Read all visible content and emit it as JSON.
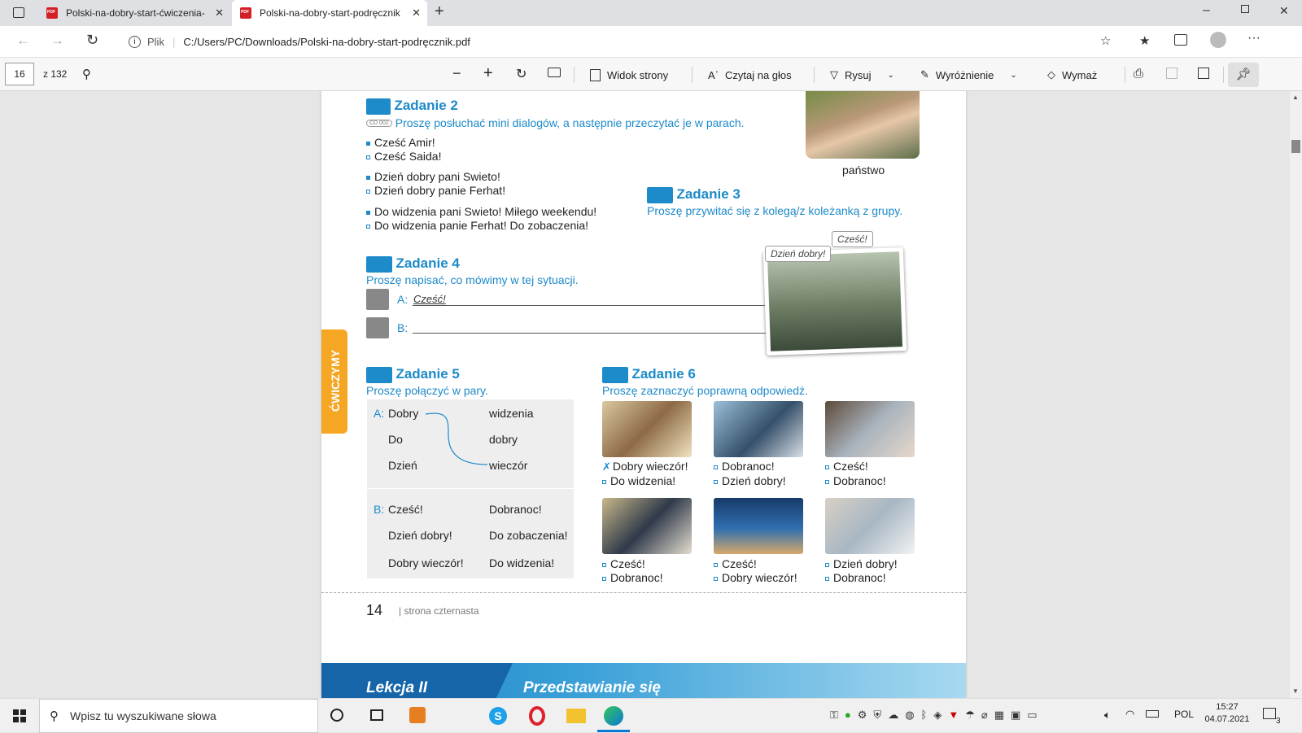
{
  "tabs": [
    {
      "label": "Polski-na-dobry-start-ćwiczenia-"
    },
    {
      "label": "Polski-na-dobry-start-podręcznik"
    }
  ],
  "address": {
    "scheme": "Plik",
    "url": "C:/Users/PC/Downloads/Polski-na-dobry-start-podręcznik.pdf"
  },
  "pdf_toolbar": {
    "page": "16",
    "of": "z 132",
    "page_view": "Widok strony",
    "read_aloud": "Czytaj na głos",
    "draw": "Rysuj",
    "highlight": "Wyróżnienie",
    "erase": "Wymaż"
  },
  "page": {
    "z2": {
      "title": "Zadanie 2",
      "badge": "CD 002",
      "subtitle": "Proszę posłuchać mini dialogów, a następnie przeczytać je w parach.",
      "lines": [
        "Cześć Amir!",
        "Cześć Saida!",
        "Dzień dobry pani Swieto!",
        "Dzień dobry panie Ferhat!",
        "Do widzenia pani Swieto! Miłego weekendu!",
        "Do widzenia panie Ferhat! Do zobaczenia!"
      ]
    },
    "photo_caption": "państwo",
    "z3": {
      "title": "Zadanie 3",
      "subtitle": "Proszę przywitać się z kolegą/z koleżanką z grupy."
    },
    "z4": {
      "title": "Zadanie 4",
      "subtitle": "Proszę napisać, co mówimy w tej sytuacji.",
      "a_label": "A:",
      "a_answer": "Cześć!",
      "b_label": "B:",
      "bubble1": "Dzień dobry!",
      "bubble2": "Cześć!"
    },
    "side_tab": "ĆWICZYMY",
    "z5": {
      "title": "Zadanie 5",
      "subtitle": "Proszę połączyć w pary.",
      "a_label": "A:",
      "a_left": [
        "Dobry",
        "Do",
        "Dzień"
      ],
      "a_right": [
        "widzenia",
        "dobry",
        "wieczór"
      ],
      "b_label": "B:",
      "b_left": [
        "Cześć!",
        "Dzień dobry!",
        "Dobry wieczór!"
      ],
      "b_right": [
        "Dobranoc!",
        "Do zobaczenia!",
        "Do widzenia!"
      ]
    },
    "z6": {
      "title": "Zadanie 6",
      "subtitle": "Proszę zaznaczyć poprawną odpowiedź.",
      "options": [
        [
          "Dobry wieczór!",
          "Do widzenia!"
        ],
        [
          "Dobranoc!",
          "Dzień dobry!"
        ],
        [
          "Cześć!",
          "Dobranoc!"
        ],
        [
          "Cześć!",
          "Dobranoc!"
        ],
        [
          "Cześć!",
          "Dobry wieczór!"
        ],
        [
          "Dzień dobry!",
          "Dobranoc!"
        ]
      ]
    },
    "page_number": "14",
    "page_words": "| strona czternasta",
    "next_lesson": "Lekcja II",
    "next_title": "Przedstawianie się"
  },
  "taskbar": {
    "search": "Wpisz tu wyszukiwane słowa",
    "lang": "POL",
    "time": "15:27",
    "date": "04.07.2021",
    "notif": "3"
  }
}
